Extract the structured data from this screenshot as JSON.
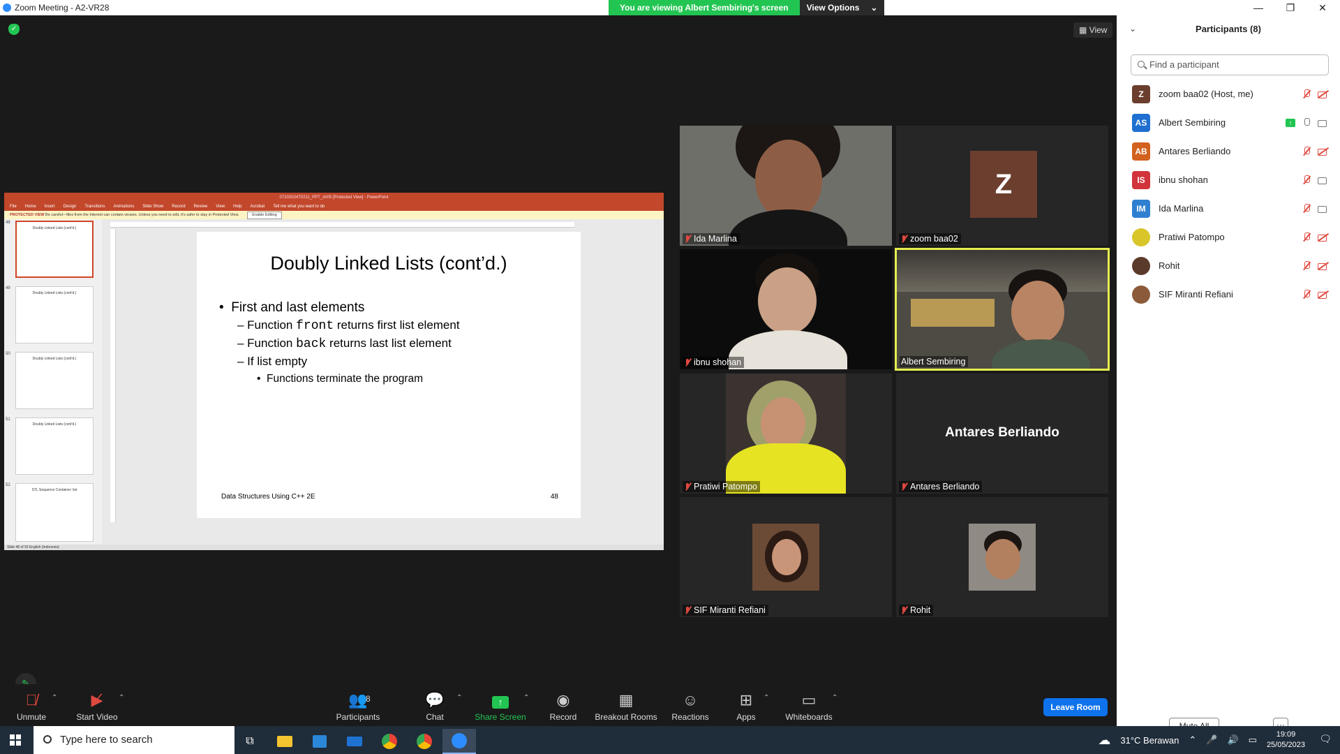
{
  "window": {
    "title": "Zoom Meeting - A2-VR28"
  },
  "banner": {
    "viewing": "You are viewing Albert Sembiring's screen",
    "view_options": "View Options"
  },
  "view_button": "View",
  "shared_screen": {
    "ppt_title": "07102024T0211_PPT_ch05 [Protected View] - PowerPoint",
    "menu": [
      "File",
      "Home",
      "Insert",
      "Design",
      "Transitions",
      "Animations",
      "Slide Show",
      "Record",
      "Review",
      "View",
      "Help",
      "Acrobat",
      "Tell me what you want to do"
    ],
    "protected_label": "PROTECTED VIEW",
    "protected_msg": "Be careful—files from the Internet can contain viruses. Unless you need to edit, it's safer to stay in Protected View.",
    "enable_editing": "Enable Editing",
    "thumbnails": [
      {
        "num": "48",
        "title": "Doubly Linked Lists (cont'd.)"
      },
      {
        "num": "49",
        "title": "Doubly Linked Lists (cont'd.)"
      },
      {
        "num": "50",
        "title": "Doubly Linked Lists (cont'd.)"
      },
      {
        "num": "51",
        "title": "Doubly Linked Lists (cont'd.)"
      },
      {
        "num": "52",
        "title": "STL Sequence Container: list"
      }
    ],
    "slide": {
      "title": "Doubly Linked Lists (cont’d.)",
      "b1": "First and last elements",
      "b2_pre": "– Function ",
      "b2_code": "front",
      "b2_post": " returns first list element",
      "b3_pre": "– Function ",
      "b3_code": "back",
      "b3_post": " returns last list element",
      "b4": "– If list empty",
      "b5": "Functions terminate the program",
      "footer": "Data Structures Using C++ 2E",
      "page": "48"
    },
    "status": "Slide 48 of 93     English (Indonesia)"
  },
  "tiles": [
    {
      "name": "Ida Marlina"
    },
    {
      "name": "zoom baa02",
      "initial": "Z"
    },
    {
      "name": "ibnu shohan"
    },
    {
      "name": "Albert Sembiring"
    },
    {
      "name": "Pratiwi Patompo"
    },
    {
      "name": "Antares Berliando",
      "big": "Antares Berliando"
    },
    {
      "name": "SIF Miranti Refiani"
    },
    {
      "name": "Rohit"
    }
  ],
  "participants": {
    "header": "Participants (8)",
    "search_placeholder": "Find a participant",
    "list": [
      {
        "initials": "Z",
        "name": "zoom baa02 (Host, me)",
        "color": "#6b3e2e"
      },
      {
        "initials": "AS",
        "name": "Albert Sembiring",
        "color": "#1f6fd1"
      },
      {
        "initials": "AB",
        "name": "Antares Berliando",
        "color": "#d2621e"
      },
      {
        "initials": "IS",
        "name": "ibnu shohan",
        "color": "#d1343a"
      },
      {
        "initials": "IM",
        "name": "Ida Marlina",
        "color": "#2f80d1"
      },
      {
        "initials": "",
        "name": "Pratiwi Patompo",
        "color": "#d8c62a"
      },
      {
        "initials": "",
        "name": "Rohit",
        "color": "#5a3a2a"
      },
      {
        "initials": "",
        "name": "SIF Miranti Refiani",
        "color": "#8a5a3a"
      }
    ],
    "mute_all": "Mute All",
    "more": "···"
  },
  "toolbar": {
    "unmute": "Unmute",
    "start_video": "Start Video",
    "participants": "Participants",
    "participants_count": "8",
    "chat": "Chat",
    "share_screen": "Share Screen",
    "record": "Record",
    "breakout_rooms": "Breakout Rooms",
    "reactions": "Reactions",
    "apps": "Apps",
    "whiteboards": "Whiteboards",
    "leave": "Leave Room"
  },
  "taskbar": {
    "search_placeholder": "Type here to search",
    "weather": "31°C  Berawan",
    "time": "19:09",
    "date": "25/05/2023"
  }
}
